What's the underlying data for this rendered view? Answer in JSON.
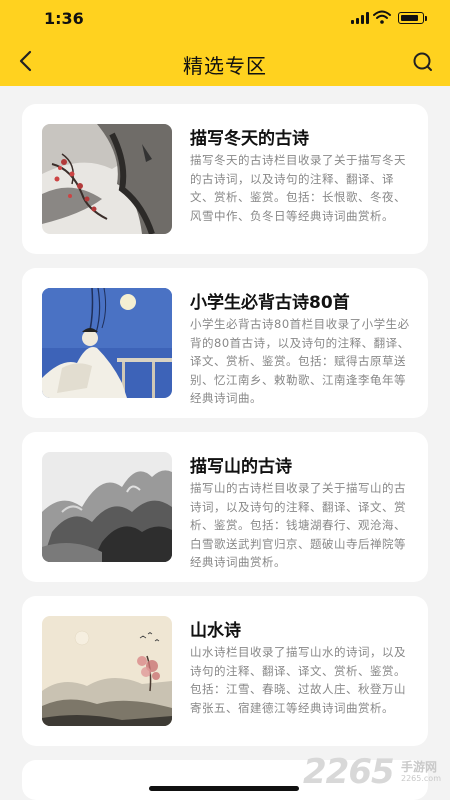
{
  "status_bar": {
    "time": "1:36"
  },
  "nav": {
    "title": "精选专区"
  },
  "cards": [
    {
      "title": "描写冬天的古诗",
      "description": "描写冬天的古诗栏目收录了关于描写冬天的古诗词，以及诗句的注释、翻译、译文、赏析、鉴赏。包括：长恨歌、冬夜、风雪中作、负冬日等经典诗词曲赏析。",
      "image": "winter-plum-painting"
    },
    {
      "title": "小学生必背古诗80首",
      "description": "小学生必背古诗80首栏目收录了小学生必背的80首古诗，以及诗句的注释、翻译、译文、赏析、鉴赏。包括：赋得古原草送别、忆江南乡、敕勒歌、江南逢李龟年等经典诗词曲。",
      "image": "poet-moonlight-painting"
    },
    {
      "title": "描写山的古诗",
      "description": "描写山的古诗栏目收录了关于描写山的古诗词，以及诗句的注释、翻译、译文、赏析、鉴赏。包括：钱塘湖春行、观沧海、白雪歌送武判官归京、题破山寺后禅院等经典诗词曲赏析。",
      "image": "ink-mountain-painting"
    },
    {
      "title": "山水诗",
      "description": "山水诗栏目收录了描写山水的诗词，以及诗句的注释、翻译、译文、赏析、鉴赏。包括：江雪、春晓、过故人庄、秋登万山寄张五、宿建德江等经典诗词曲赏析。",
      "image": "landscape-ink-painting"
    }
  ],
  "watermark": {
    "number": "2265",
    "text": "手游网",
    "sub": "2265.com"
  }
}
